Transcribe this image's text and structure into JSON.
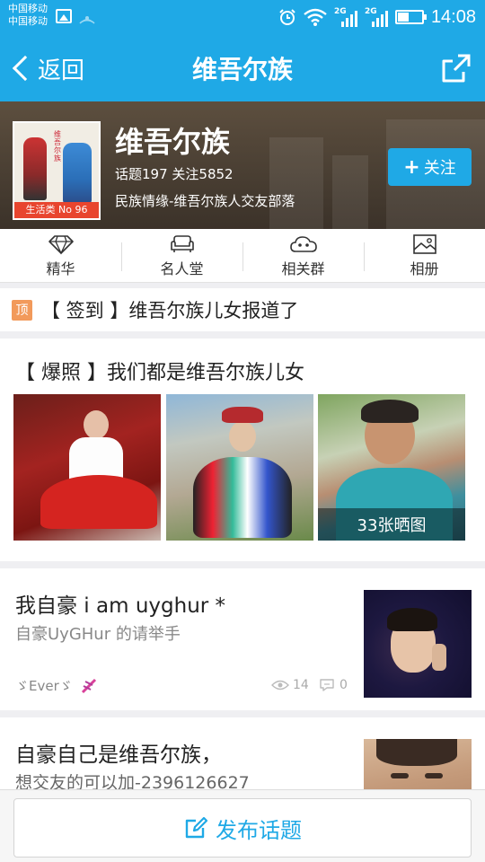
{
  "status_bar": {
    "carrier1": "中国移动",
    "carrier2": "中国移动",
    "net1": "2G",
    "net2": "2G",
    "time": "14:08"
  },
  "nav": {
    "back_label": "返回",
    "title": "维吾尔族"
  },
  "group": {
    "name": "维吾尔族",
    "topics_label": "话题197",
    "follows_label": "关注5852",
    "description": "民族情缘-维吾尔族人交友部落",
    "rank_badge": "生活类 No 96",
    "follow_label": "关注",
    "cover_text": "维吾尔族"
  },
  "tabs": [
    {
      "label": "精华",
      "icon": "diamond-icon"
    },
    {
      "label": "名人堂",
      "icon": "sofa-icon"
    },
    {
      "label": "相关群",
      "icon": "cloud-group-icon"
    },
    {
      "label": "相册",
      "icon": "photo-icon"
    }
  ],
  "pinned": {
    "badge": "顶",
    "title": "【 签到 】维吾尔族儿女报道了"
  },
  "posts": [
    {
      "title": "【 爆照 】我们都是维吾尔族儿女",
      "photo_count_label": "33张晒图"
    },
    {
      "title": "我自豪  i am   uyghur *",
      "subtitle": "自豪UyGHur  的请举手",
      "author": "ゞEverゞ",
      "views": "14",
      "comments": "0"
    },
    {
      "title": "自豪自己是维吾尔族，",
      "subtitle": "想交友的可以加-2396126627"
    }
  ],
  "bottom": {
    "post_label": "发布话题"
  },
  "colors": {
    "accent": "#1fa9e6",
    "rank_badge": "#e8452e",
    "pin_badge": "#f29a5b"
  }
}
